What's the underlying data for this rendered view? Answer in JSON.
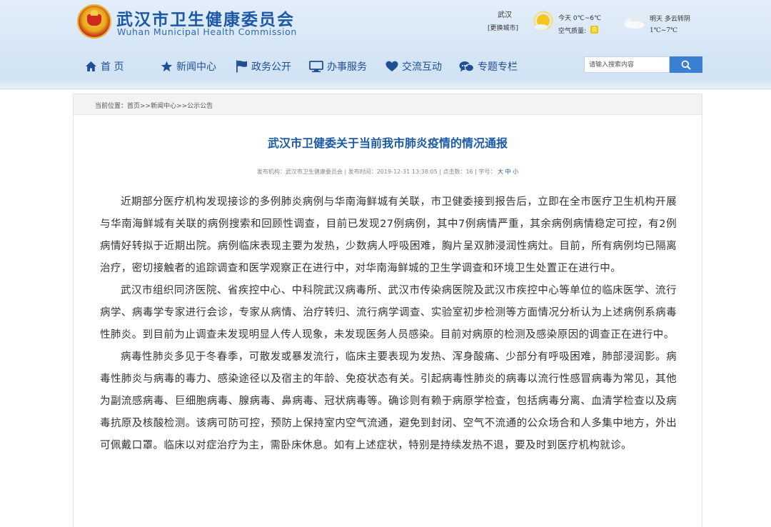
{
  "header": {
    "title_cn": "武汉市卫生健康委员会",
    "title_en": "Wuhan Municipal Health Commission"
  },
  "weather": {
    "city": "武汉",
    "switch_city": "[更换城市]",
    "today": "今天 0℃~6℃",
    "aqi_label": "空气质量:",
    "aqi_value": "良",
    "tomorrow": "明天 多云转阴",
    "tomorrow_temp": "1℃~7℃",
    "icons": [
      "sun-icon",
      "cloud-icon"
    ]
  },
  "nav": {
    "items": [
      {
        "label": "首 页",
        "icon": "home-icon"
      },
      {
        "label": "新闻中心",
        "icon": "star-icon"
      },
      {
        "label": "政务公开",
        "icon": "flag-icon"
      },
      {
        "label": "办事服务",
        "icon": "monitor-icon"
      },
      {
        "label": "交流互动",
        "icon": "heart-icon"
      },
      {
        "label": "专题专栏",
        "icon": "chat-icon"
      }
    ],
    "search_placeholder": "请输入搜索内容",
    "search_icon": "search-icon"
  },
  "colors": {
    "nav_text": "#1f4f95",
    "title": "#1d5aa6",
    "search_button": "#3a7fd2"
  },
  "breadcrumb": "当前位置：首页>>新闻中心>>公示公告",
  "article": {
    "title": "武汉市卫健委关于当前我市肺炎疫情的情况通报",
    "meta": {
      "prefix": "发布机构：武汉市卫生健康委员会 | 发布时间：2019-12-31 13:38:05 | 点击数：16 | 字号：",
      "size_large": "大",
      "size_medium": "中",
      "size_small": "小"
    },
    "paragraphs": [
      "近期部分医疗机构发现接诊的多例肺炎病例与华南海鲜城有关联，市卫健委接到报告后，立即在全市医疗卫生机构开展与华南海鲜城有关联的病例搜索和回顾性调查，目前已发现27例病例，其中7例病情严重，其余病例病情稳定可控，有2例病情好转拟于近期出院。病例临床表现主要为发热，少数病人呼吸困难，胸片呈双肺浸润性病灶。目前，所有病例均已隔离治疗，密切接触者的追踪调查和医学观察正在进行中，对华南海鲜城的卫生学调查和环境卫生处置正在进行中。",
      "武汉市组织同济医院、省疾控中心、中科院武汉病毒所、武汉市传染病医院及武汉市疾控中心等单位的临床医学、流行病学、病毒学专家进行会诊，专家从病情、治疗转归、流行病学调查、实验室初步检测等方面情况分析认为上述病例系病毒性肺炎。到目前为止调查未发现明显人传人现象，未发现医务人员感染。目前对病原的检测及感染原因的调查正在进行中。",
      "病毒性肺炎多见于冬春季，可散发或暴发流行，临床主要表现为发热、浑身酸痛、少部分有呼吸困难，肺部浸润影。病毒性肺炎与病毒的毒力、感染途径以及宿主的年龄、免疫状态有关。引起病毒性肺炎的病毒以流行性感冒病毒为常见，其他为副流感病毒、巨细胞病毒、腺病毒、鼻病毒、冠状病毒等。确诊则有赖于病原学检查，包括病毒分离、血清学检查以及病毒抗原及核酸检测。该病可防可控，预防上保持室内空气流通，避免到封闭、空气不流通的公众场合和人多集中地方，外出可佩戴口罩。临床以对症治疗为主，需卧床休息。如有上述症状，特别是持续发热不退，要及时到医疗机构就诊。"
    ]
  }
}
